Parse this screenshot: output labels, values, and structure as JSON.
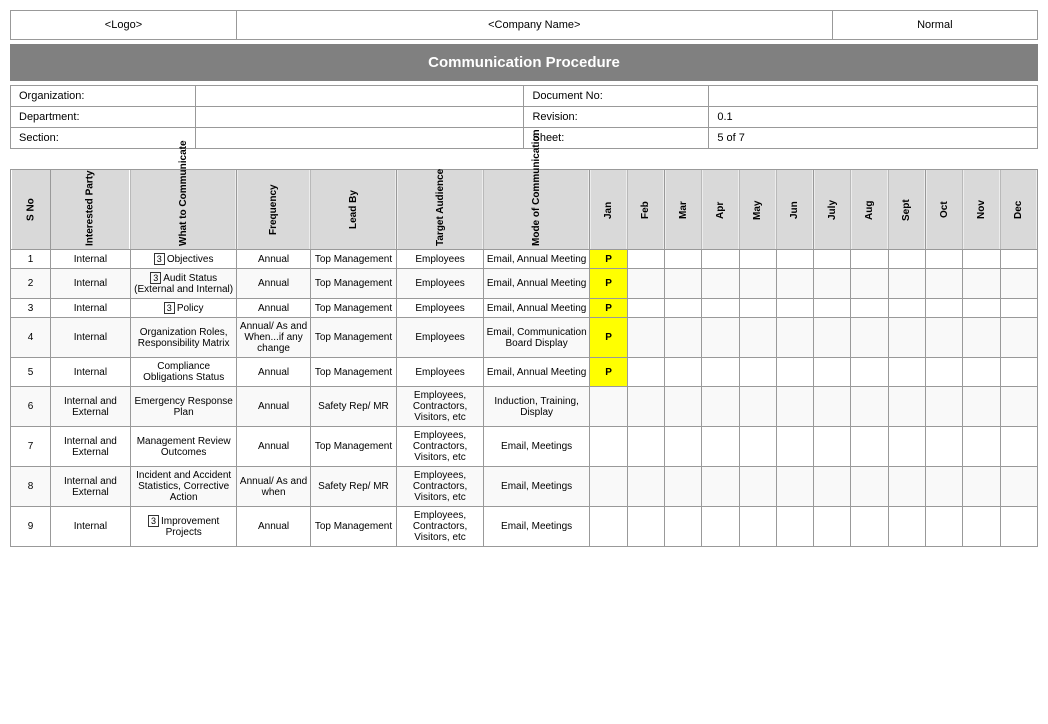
{
  "header": {
    "logo": "<Logo>",
    "company": "<Company Name>",
    "normal": "Normal"
  },
  "title": "Communication Procedure",
  "info": {
    "organization_label": "Organization:",
    "organization_value": "",
    "document_no_label": "Document No:",
    "document_no_value": "",
    "department_label": "Department:",
    "department_value": "",
    "revision_label": "Revision:",
    "revision_value": "0.1",
    "section_label": "Section:",
    "section_value": "",
    "sheet_label": "Sheet:",
    "sheet_value": "5 of 7"
  },
  "table": {
    "columns": [
      "S No",
      "Interested Party",
      "What to Communicate",
      "Frequency",
      "Lead By",
      "Target Audience",
      "Mode of Communication",
      "Jan",
      "Feb",
      "Mar",
      "Apr",
      "May",
      "Jun",
      "July",
      "Aug",
      "Sept",
      "Oct",
      "Nov",
      "Dec"
    ],
    "rows": [
      {
        "sno": "1",
        "interested_party": "Internal",
        "what": "[3] Objectives",
        "what_tag": "3",
        "frequency": "Annual",
        "lead_by": "Top Management",
        "target": "Employees",
        "mode": "Email, Annual Meeting",
        "jan": "P",
        "jan_highlight": true,
        "feb": "",
        "mar": "",
        "apr": "",
        "may": "",
        "jun": "",
        "jul": "",
        "aug": "",
        "sept": "",
        "oct": "",
        "nov": "",
        "dec": ""
      },
      {
        "sno": "2",
        "interested_party": "Internal",
        "what": "[3] Audit Status (External and Internal)",
        "what_tag": "3",
        "frequency": "Annual",
        "lead_by": "Top Management",
        "target": "Employees",
        "mode": "Email, Annual Meeting",
        "jan": "P",
        "jan_highlight": true,
        "feb": "",
        "mar": "",
        "apr": "",
        "may": "",
        "jun": "",
        "jul": "",
        "aug": "",
        "sept": "",
        "oct": "",
        "nov": "",
        "dec": ""
      },
      {
        "sno": "3",
        "interested_party": "Internal",
        "what": "[3] Policy",
        "what_tag": "3",
        "frequency": "Annual",
        "lead_by": "Top Management",
        "target": "Employees",
        "mode": "Email, Annual Meeting",
        "jan": "P",
        "jan_highlight": true,
        "feb": "",
        "mar": "",
        "apr": "",
        "may": "",
        "jun": "",
        "jul": "",
        "aug": "",
        "sept": "",
        "oct": "",
        "nov": "",
        "dec": ""
      },
      {
        "sno": "4",
        "interested_party": "Internal",
        "what": "Organization Roles, Responsibility Matrix",
        "what_tag": "",
        "frequency": "Annual/ As and When...if any change",
        "lead_by": "Top Management",
        "target": "Employees",
        "mode": "Email, Communication Board Display",
        "jan": "P",
        "jan_highlight": true,
        "feb": "",
        "mar": "",
        "apr": "",
        "may": "",
        "jun": "",
        "jul": "",
        "aug": "",
        "sept": "",
        "oct": "",
        "nov": "",
        "dec": ""
      },
      {
        "sno": "5",
        "interested_party": "Internal",
        "what": "Compliance Obligations Status",
        "what_tag": "",
        "frequency": "Annual",
        "lead_by": "Top Management",
        "target": "Employees",
        "mode": "Email, Annual Meeting",
        "jan": "P",
        "jan_highlight": true,
        "feb": "",
        "mar": "",
        "apr": "",
        "may": "",
        "jun": "",
        "jul": "",
        "aug": "",
        "sept": "",
        "oct": "",
        "nov": "",
        "dec": ""
      },
      {
        "sno": "6",
        "interested_party": "Internal and External",
        "what": "Emergency Response Plan",
        "what_tag": "",
        "frequency": "Annual",
        "lead_by": "Safety Rep/ MR",
        "target": "Employees, Contractors, Visitors, etc",
        "mode": "Induction, Training, Display",
        "jan": "",
        "jan_highlight": false,
        "feb": "",
        "mar": "",
        "apr": "",
        "may": "",
        "jun": "",
        "jul": "",
        "aug": "",
        "sept": "",
        "oct": "",
        "nov": "",
        "dec": ""
      },
      {
        "sno": "7",
        "interested_party": "Internal and External",
        "what": "Management Review Outcomes",
        "what_tag": "",
        "frequency": "Annual",
        "lead_by": "Top Management",
        "target": "Employees, Contractors, Visitors, etc",
        "mode": "Email, Meetings",
        "jan": "",
        "jan_highlight": false,
        "feb": "",
        "mar": "",
        "apr": "",
        "may": "",
        "jun": "",
        "jul": "",
        "aug": "",
        "sept": "",
        "oct": "",
        "nov": "",
        "dec": ""
      },
      {
        "sno": "8",
        "interested_party": "Internal and External",
        "what": "Incident and Accident Statistics, Corrective Action",
        "what_tag": "",
        "frequency": "Annual/ As and when",
        "lead_by": "Safety Rep/ MR",
        "target": "Employees, Contractors, Visitors, etc",
        "mode": "Email, Meetings",
        "jan": "",
        "jan_highlight": false,
        "feb": "",
        "mar": "",
        "apr": "",
        "may": "",
        "jun": "",
        "jul": "",
        "aug": "",
        "sept": "",
        "oct": "",
        "nov": "",
        "dec": ""
      },
      {
        "sno": "9",
        "interested_party": "Internal",
        "what": "[3] Improvement Projects",
        "what_tag": "3",
        "frequency": "Annual",
        "lead_by": "Top Management",
        "target": "Employees, Contractors, Visitors, etc",
        "mode": "Email, Meetings",
        "jan": "",
        "jan_highlight": false,
        "feb": "",
        "mar": "",
        "apr": "",
        "may": "",
        "jun": "",
        "jul": "",
        "aug": "",
        "sept": "",
        "oct": "",
        "nov": "",
        "dec": ""
      }
    ]
  }
}
